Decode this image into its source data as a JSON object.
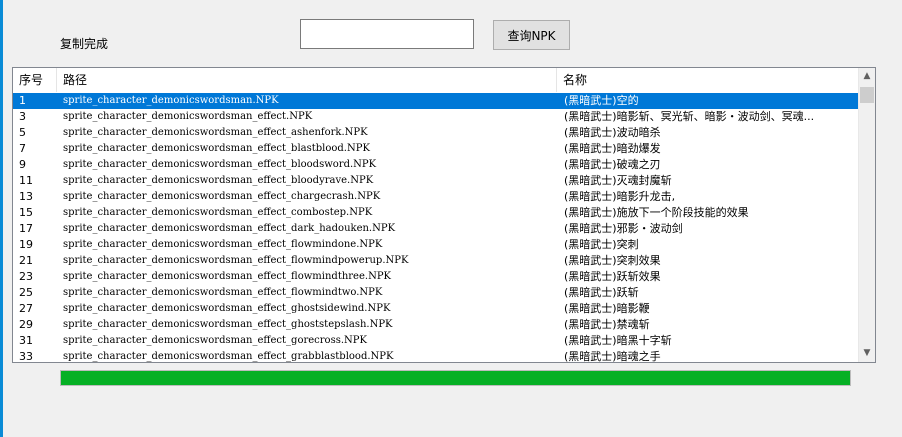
{
  "status_text": "复制完成",
  "search": {
    "value": "",
    "placeholder": ""
  },
  "query_button_label": "查询NPK",
  "table": {
    "columns": [
      "序号",
      "路径",
      "名称"
    ],
    "rows": [
      {
        "idx": "1",
        "path": "sprite_character_demonicswordsman.NPK",
        "name": "(黑暗武士)空的",
        "selected": true
      },
      {
        "idx": "3",
        "path": "sprite_character_demonicswordsman_effect.NPK",
        "name": "(黑暗武士)暗影斩、冥光斩、暗影・波动剑、冥魂..."
      },
      {
        "idx": "5",
        "path": "sprite_character_demonicswordsman_effect_ashenfork.NPK",
        "name": "(黑暗武士)波动暗杀"
      },
      {
        "idx": "7",
        "path": "sprite_character_demonicswordsman_effect_blastblood.NPK",
        "name": "(黑暗武士)暗劲爆发"
      },
      {
        "idx": "9",
        "path": "sprite_character_demonicswordsman_effect_bloodsword.NPK",
        "name": "(黑暗武士)破魂之刃"
      },
      {
        "idx": "11",
        "path": "sprite_character_demonicswordsman_effect_bloodyrave.NPK",
        "name": "(黑暗武士)灭魂封魔斩"
      },
      {
        "idx": "13",
        "path": "sprite_character_demonicswordsman_effect_chargecrash.NPK",
        "name": "(黑暗武士)暗影升龙击,"
      },
      {
        "idx": "15",
        "path": "sprite_character_demonicswordsman_effect_combostep.NPK",
        "name": "(黑暗武士)施放下一个阶段技能的效果"
      },
      {
        "idx": "17",
        "path": "sprite_character_demonicswordsman_effect_dark_hadouken.NPK",
        "name": "(黑暗武士)邪影・波动剑"
      },
      {
        "idx": "19",
        "path": "sprite_character_demonicswordsman_effect_flowmindone.NPK",
        "name": "(黑暗武士)突刺"
      },
      {
        "idx": "21",
        "path": "sprite_character_demonicswordsman_effect_flowmindpowerup.NPK",
        "name": "(黑暗武士)突刺效果"
      },
      {
        "idx": "23",
        "path": "sprite_character_demonicswordsman_effect_flowmindthree.NPK",
        "name": "(黑暗武士)跃斩效果"
      },
      {
        "idx": "25",
        "path": "sprite_character_demonicswordsman_effect_flowmindtwo.NPK",
        "name": "(黑暗武士)跃斩"
      },
      {
        "idx": "27",
        "path": "sprite_character_demonicswordsman_effect_ghostsidewind.NPK",
        "name": "(黑暗武士)暗影鞭"
      },
      {
        "idx": "29",
        "path": "sprite_character_demonicswordsman_effect_ghoststepslash.NPK",
        "name": "(黑暗武士)禁魂斩"
      },
      {
        "idx": "31",
        "path": "sprite_character_demonicswordsman_effect_gorecross.NPK",
        "name": "(黑暗武士)暗黑十字斩"
      },
      {
        "idx": "33",
        "path": "sprite_character_demonicswordsman_effect_grabblastblood.NPK",
        "name": "(黑暗武士)暗魂之手"
      }
    ]
  },
  "progress": {
    "value_percent": 100,
    "fill_color": "#06b025"
  },
  "colors": {
    "selection": "#0078d7",
    "window_edge": "#0a8bd6"
  },
  "icons": {
    "scroll_up": "chevron-up-icon",
    "scroll_down": "chevron-down-icon"
  }
}
